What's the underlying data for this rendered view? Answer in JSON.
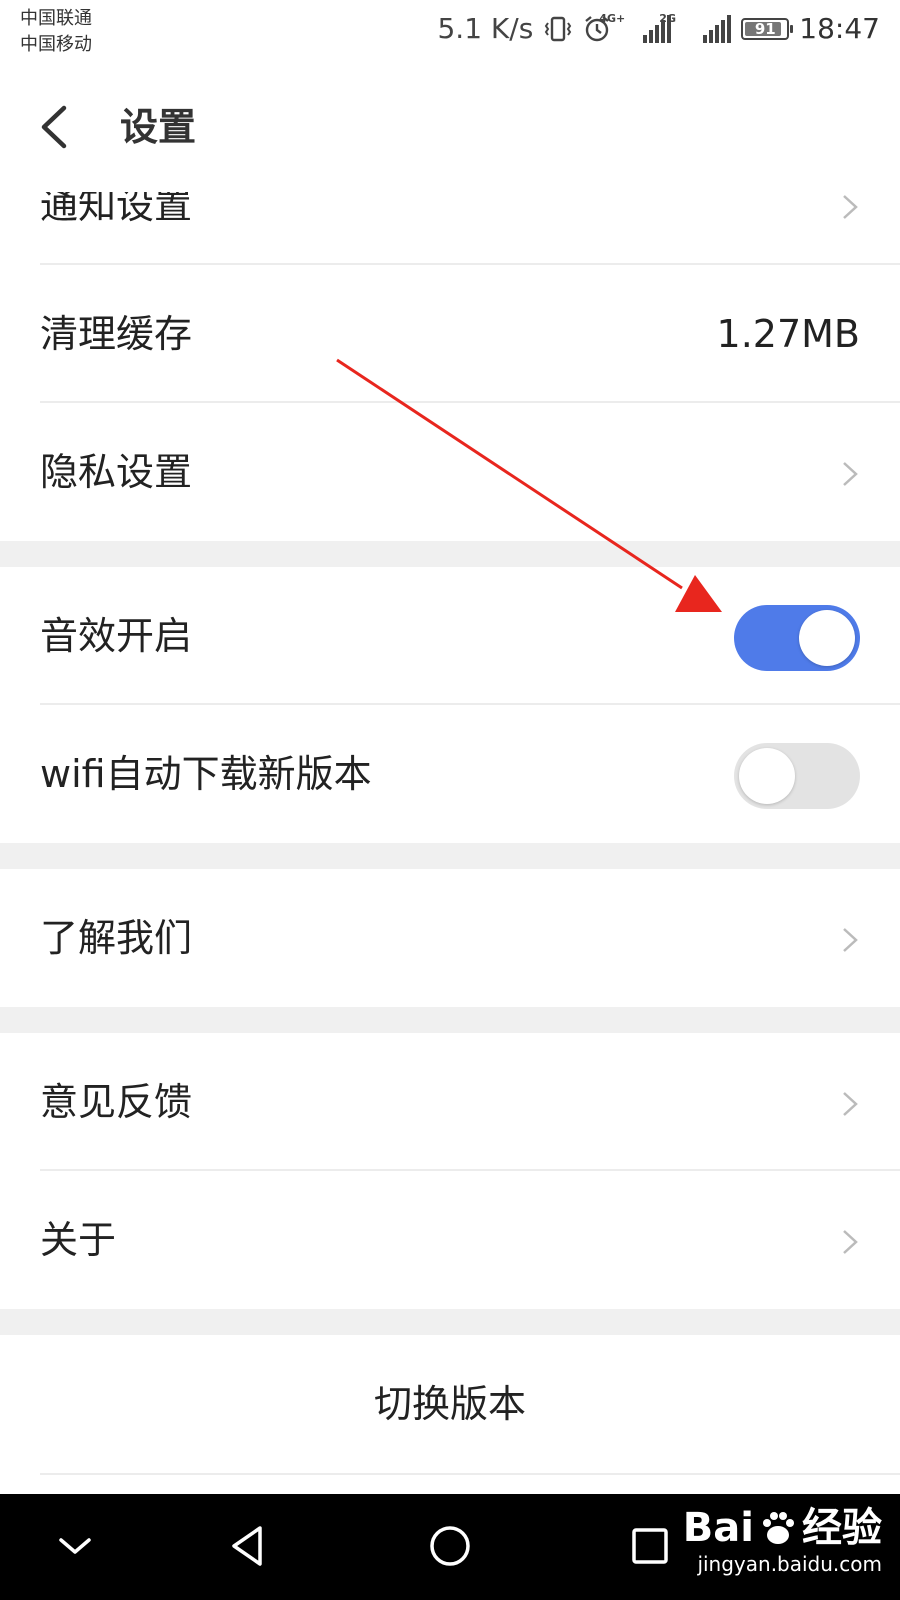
{
  "status_bar": {
    "carrier_1": "中国联通",
    "carrier_2": "中国移动",
    "speed": "5.1 K/s",
    "net_1": "4G+",
    "net_2": "2G",
    "battery_level": "91",
    "time": "18:47"
  },
  "header": {
    "title": "设置"
  },
  "settings": {
    "notification": {
      "label": "通知设置"
    },
    "clear_cache": {
      "label": "清理缓存",
      "value": "1.27MB"
    },
    "privacy": {
      "label": "隐私设置"
    },
    "sound": {
      "label": "音效开启",
      "on": true
    },
    "wifi_update": {
      "label": "wifi自动下载新版本",
      "on": false
    },
    "about_us": {
      "label": "了解我们"
    },
    "feedback": {
      "label": "意见反馈"
    },
    "about": {
      "label": "关于"
    },
    "switch_version": {
      "label": "切换版本"
    }
  },
  "watermark": {
    "brand": "Bai",
    "brand_suffix": "经验",
    "url": "jingyan.baidu.com"
  },
  "colors": {
    "accent": "#4f7be9",
    "toggle_off": "#e3e3e3",
    "annotation_arrow": "#e8261e"
  }
}
